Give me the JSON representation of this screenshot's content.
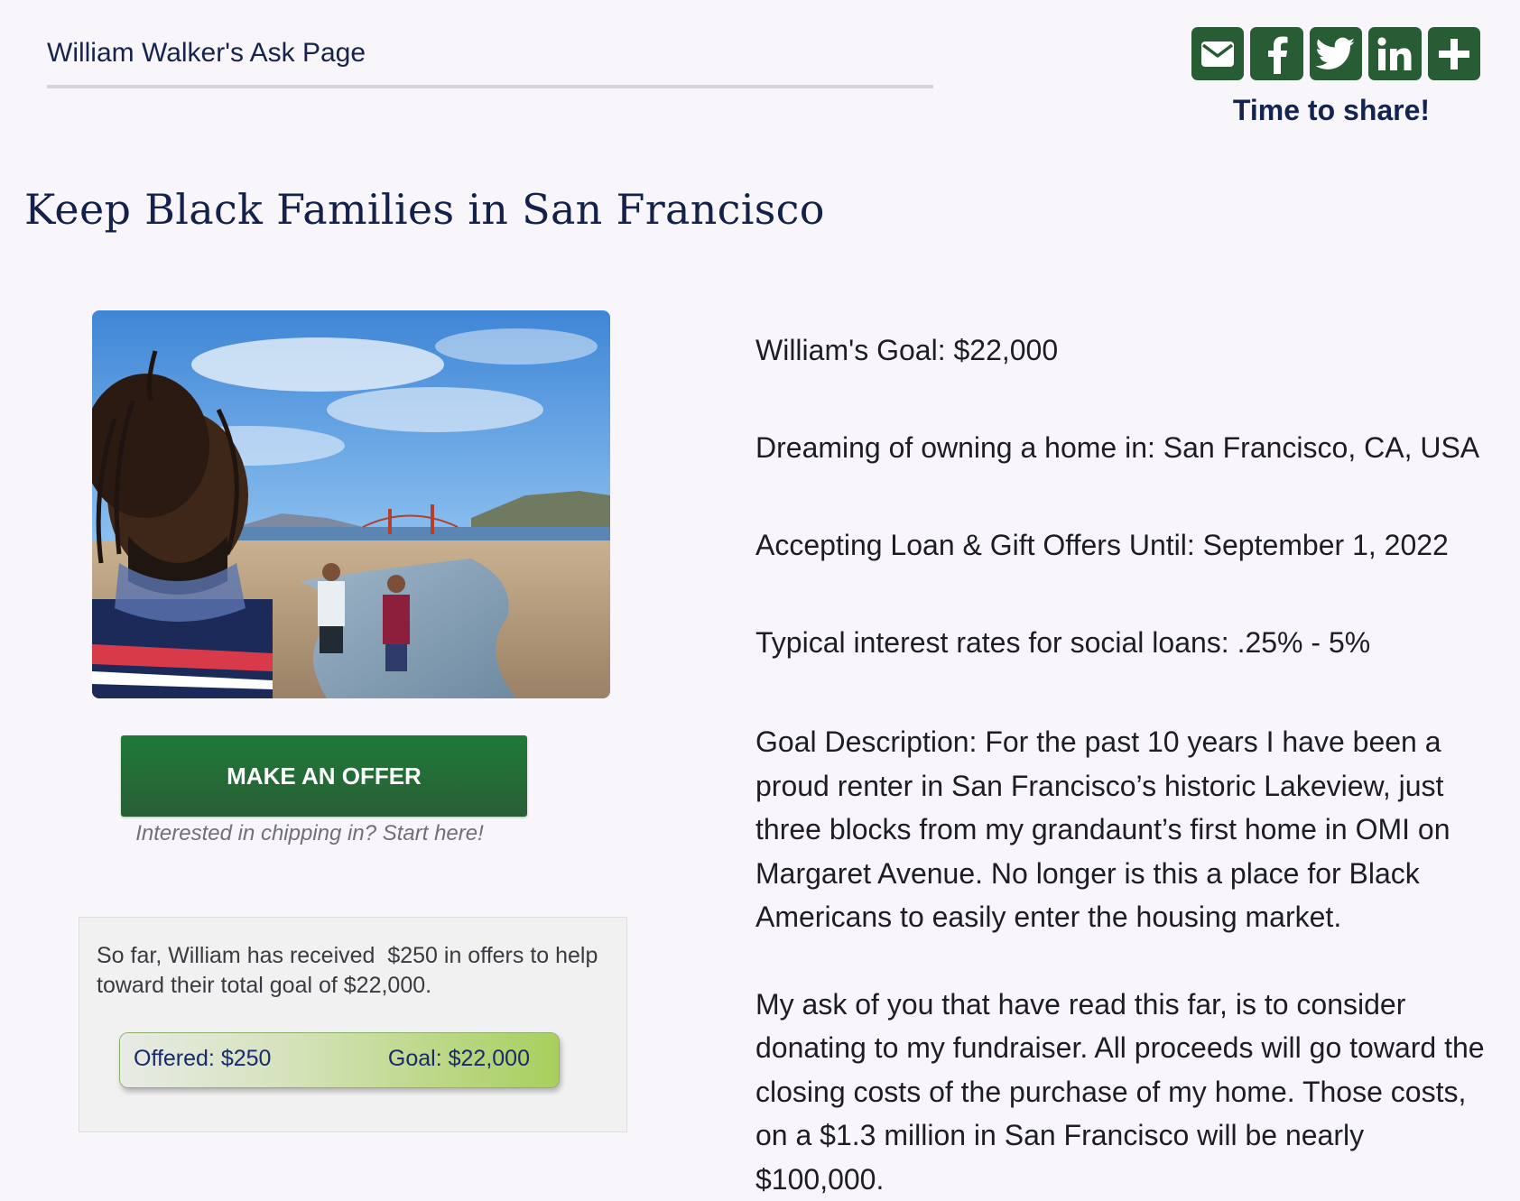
{
  "breadcrumb": "William Walker's Ask Page",
  "share": {
    "caption": "Time to share!",
    "buttons": [
      {
        "icon": "mail-icon"
      },
      {
        "icon": "facebook-icon"
      },
      {
        "icon": "twitter-icon"
      },
      {
        "icon": "linkedin-icon"
      },
      {
        "icon": "plus-icon"
      }
    ]
  },
  "title": "Keep Black Families in San Francisco",
  "cta": {
    "label": "MAKE AN OFFER",
    "hint": "Interested in chipping in? Start here!"
  },
  "progress": {
    "summary": "So far, William has received  $250 in offers to help toward their total goal of $22,000.",
    "offered_label": "Offered: $250",
    "goal_label": "Goal: $22,000",
    "offered_amount": 250,
    "goal_amount": 22000
  },
  "details": {
    "goal": "William's Goal: $22,000",
    "location": "Dreaming of owning a home in: San Francisco, CA, USA",
    "deadline": "Accepting Loan & Gift Offers Until: September 1, 2022",
    "rates": "Typical interest rates for social loans: .25% - 5%"
  },
  "description": {
    "paragraph1": "Goal Description: For the past 10 years I have been a proud renter in San Francisco’s historic Lakeview, just three blocks from my grandaunt’s first home in OMI on Margaret Avenue. No longer is this a place for Black Americans to easily enter the housing market.",
    "paragraph2": "My ask of you that have read this far, is to consider donating to my fundraiser. All proceeds will go toward the closing costs of the purchase of my home. Those costs, on a $1.3 million in San Francisco will be nearly $100,000."
  },
  "colors": {
    "brand_green": "#275c35",
    "button_green": "#1e7a38",
    "text_navy": "#14214a",
    "progress_green": "#a8cf5d"
  }
}
